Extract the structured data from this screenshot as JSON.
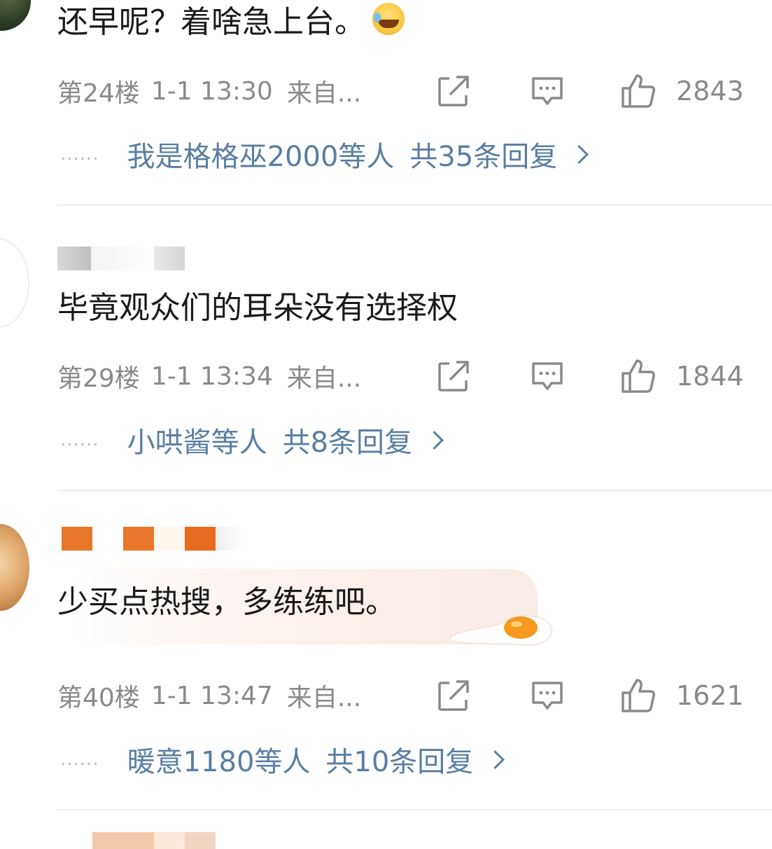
{
  "comments": [
    {
      "text": "还早呢？着啥急上台。",
      "emoji": "laughing-crying-emoji",
      "floor": "第24楼",
      "time": "1-1 13:30",
      "source": "来自...",
      "likes": "2843",
      "reply": {
        "dots": "......",
        "users": "我是格格巫2000",
        "suffix": "等人",
        "total": "共35条回复"
      }
    },
    {
      "text": "毕竟观众们的耳朵没有选择权",
      "floor": "第29楼",
      "time": "1-1 13:34",
      "source": "来自...",
      "likes": "1844",
      "reply": {
        "dots": "......",
        "users": "小哄酱",
        "suffix": "等人",
        "total": "共8条回复"
      }
    },
    {
      "text": "少买点热搜，多练练吧。",
      "floor": "第40楼",
      "time": "1-1 13:47",
      "source": "来自...",
      "likes": "1621",
      "reply": {
        "dots": "......",
        "users": "暖意1180",
        "suffix": "等人",
        "total": "共10条回复"
      }
    }
  ],
  "icons": {
    "share": "share-icon",
    "comment": "comment-icon",
    "like": "thumbs-up-icon",
    "reply_arrow": "chevron-right-icon"
  },
  "colors": {
    "link": "#5a7ea3",
    "meta": "#8a8a8a",
    "text": "#1a1a1a",
    "divider": "#ececec"
  }
}
